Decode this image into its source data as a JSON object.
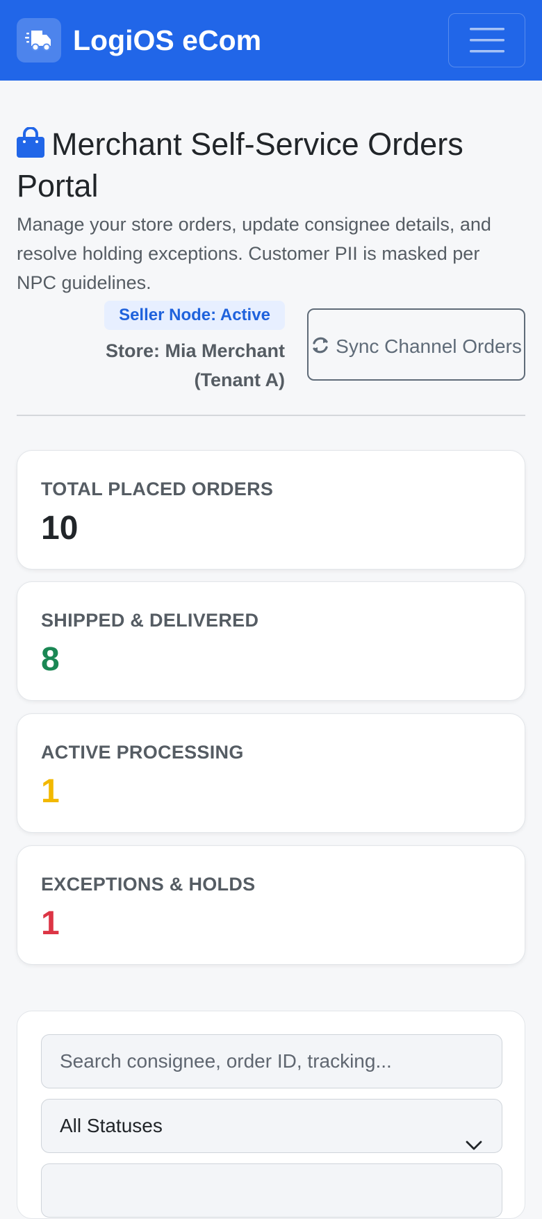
{
  "navbar": {
    "brand": "LogiOS eCom",
    "brand_icon": "truck-fast-icon",
    "menu_icon": "hamburger-menu-icon"
  },
  "header": {
    "title": "Merchant Self-Service Orders Portal",
    "title_icon": "shopping-bag-icon",
    "subtitle": "Manage your store orders, update consignee details, and resolve holding exceptions. Customer PII is masked per NPC guidelines.",
    "node_status": "Seller Node: Active",
    "store": "Store: Mia Merchant (Tenant A)",
    "sync_button": "Sync Channel Orders",
    "sync_icon": "sync-icon"
  },
  "stats": [
    {
      "label": "TOTAL PLACED ORDERS",
      "value": "10",
      "color": "#212529"
    },
    {
      "label": "SHIPPED & DELIVERED",
      "value": "8",
      "color": "#1a8754"
    },
    {
      "label": "ACTIVE PROCESSING",
      "value": "1",
      "color": "#f2b800"
    },
    {
      "label": "EXCEPTIONS & HOLDS",
      "value": "1",
      "color": "#dc3545"
    }
  ],
  "filters": {
    "search_placeholder": "Search consignee, order ID, tracking...",
    "status_selected": "All Statuses"
  },
  "colors": {
    "primary": "#2166e8",
    "background": "#f6f7f9"
  }
}
